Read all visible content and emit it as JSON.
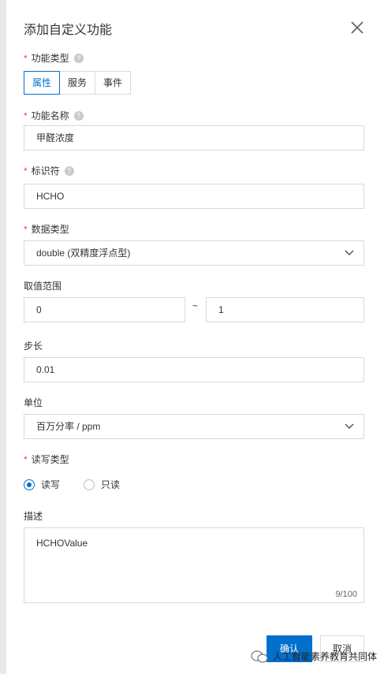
{
  "dialog": {
    "title": "添加自定义功能"
  },
  "fields": {
    "function_type": {
      "label": "功能类型",
      "options": [
        "属性",
        "服务",
        "事件"
      ],
      "selected": "属性"
    },
    "function_name": {
      "label": "功能名称",
      "value": "甲醛浓度"
    },
    "identifier": {
      "label": "标识符",
      "value": "HCHO"
    },
    "data_type": {
      "label": "数据类型",
      "value": "double (双精度浮点型)"
    },
    "range": {
      "label": "取值范围",
      "min": "0",
      "separator": "~",
      "max": "1"
    },
    "step": {
      "label": "步长",
      "value": "0.01"
    },
    "unit": {
      "label": "单位",
      "value": "百万分率 / ppm"
    },
    "rw_type": {
      "label": "读写类型",
      "options": [
        "读写",
        "只读"
      ],
      "selected": "读写"
    },
    "description": {
      "label": "描述",
      "value": "HCHOValue",
      "counter": "9/100"
    }
  },
  "buttons": {
    "confirm": "确认",
    "cancel": "取消"
  },
  "watermark": {
    "text": "人工智能素养教育共同体"
  },
  "colors": {
    "accent": "#0070cc",
    "required": "#e5483d",
    "border": "#d9d9d9"
  },
  "icons": [
    "close-icon",
    "help-icon",
    "chevron-down-icon",
    "wechat-icon"
  ]
}
